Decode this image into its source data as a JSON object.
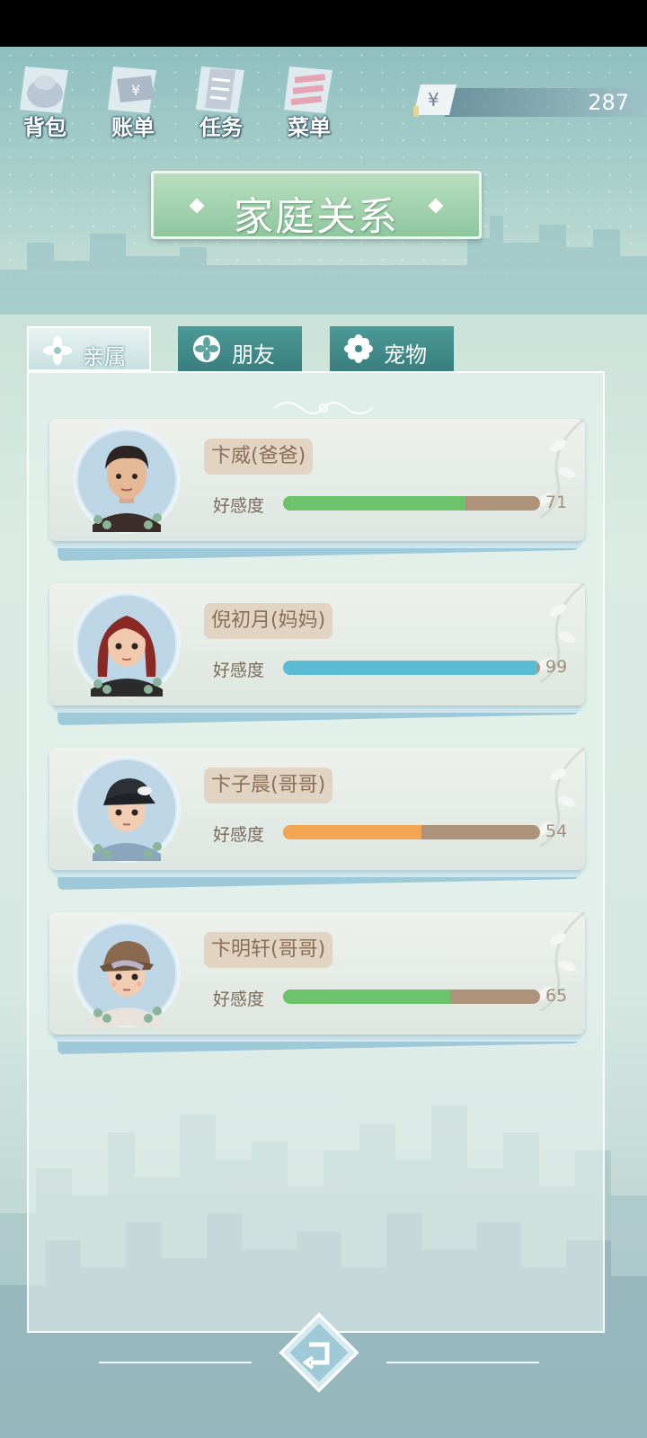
{
  "nav": {
    "items": [
      {
        "label": "背包",
        "icon": "backpack-icon"
      },
      {
        "label": "账单",
        "icon": "bill-icon"
      },
      {
        "label": "任务",
        "icon": "task-icon"
      },
      {
        "label": "菜单",
        "icon": "menu-icon"
      }
    ]
  },
  "currency": {
    "symbol": "¥",
    "value": "287"
  },
  "title": "家庭关系",
  "tabs": [
    {
      "label": "亲属",
      "active": true
    },
    {
      "label": "朋友",
      "active": false
    },
    {
      "label": "宠物",
      "active": false
    }
  ],
  "affinity_label": "好感度",
  "members": [
    {
      "name": "卞威(爸爸)",
      "affinity": 71,
      "affinity_text": "71",
      "bar_color": "#6cc36b"
    },
    {
      "name": "倪初月(妈妈)",
      "affinity": 99,
      "affinity_text": "99",
      "bar_color": "#5bbcd6"
    },
    {
      "name": "卞子晨(哥哥)",
      "affinity": 54,
      "affinity_text": "54",
      "bar_color": "#f2a553"
    },
    {
      "name": "卞明轩(哥哥)",
      "affinity": 65,
      "affinity_text": "65",
      "bar_color": "#6cc36b"
    }
  ],
  "colors": {
    "title_banner": "#9fd2ac",
    "tab_inactive": "#3f8885",
    "bar_track": "#ad937a"
  }
}
